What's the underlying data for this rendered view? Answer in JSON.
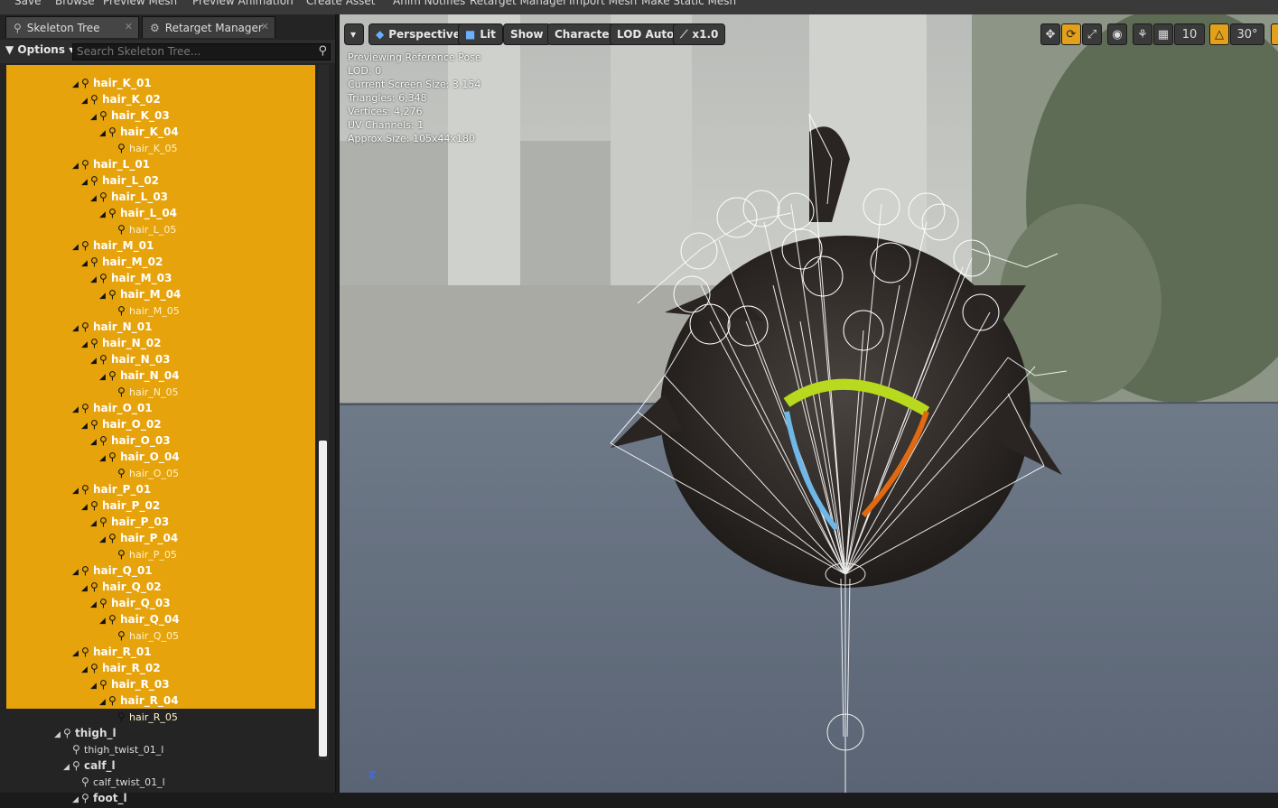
{
  "toolbar": {
    "save": "Save",
    "browse": "Browse",
    "preview_mesh": "Preview Mesh",
    "preview_animation": "Preview Animation",
    "create_asset": "Create Asset",
    "anim_notifies": "Anim Notifies",
    "retarget_manager": "Retarget Manager",
    "import_mesh": "Import Mesh",
    "make_static_mesh": "Make Static Mesh"
  },
  "tabs": {
    "skeleton_tree": "Skeleton Tree",
    "retarget_manager": "Retarget Manager"
  },
  "skeleton_tree": {
    "options_label": "Options",
    "search_placeholder": "Search Skeleton Tree...",
    "rows": [
      {
        "label": "hair_K_01",
        "level": 0,
        "kind": "parent",
        "highlight": true
      },
      {
        "label": "hair_K_02",
        "level": 1,
        "kind": "parent",
        "highlight": true
      },
      {
        "label": "hair_K_03",
        "level": 2,
        "kind": "parent",
        "highlight": true
      },
      {
        "label": "hair_K_04",
        "level": 3,
        "kind": "parent",
        "highlight": true
      },
      {
        "label": "hair_K_05",
        "level": 4,
        "kind": "leaf",
        "highlight": true
      },
      {
        "label": "hair_L_01",
        "level": 0,
        "kind": "parent",
        "highlight": true
      },
      {
        "label": "hair_L_02",
        "level": 1,
        "kind": "parent",
        "highlight": true
      },
      {
        "label": "hair_L_03",
        "level": 2,
        "kind": "parent",
        "highlight": true
      },
      {
        "label": "hair_L_04",
        "level": 3,
        "kind": "parent",
        "highlight": true
      },
      {
        "label": "hair_L_05",
        "level": 4,
        "kind": "leaf",
        "highlight": true
      },
      {
        "label": "hair_M_01",
        "level": 0,
        "kind": "parent",
        "highlight": true
      },
      {
        "label": "hair_M_02",
        "level": 1,
        "kind": "parent",
        "highlight": true
      },
      {
        "label": "hair_M_03",
        "level": 2,
        "kind": "parent",
        "highlight": true
      },
      {
        "label": "hair_M_04",
        "level": 3,
        "kind": "parent",
        "highlight": true
      },
      {
        "label": "hair_M_05",
        "level": 4,
        "kind": "leaf",
        "highlight": true
      },
      {
        "label": "hair_N_01",
        "level": 0,
        "kind": "parent",
        "highlight": true
      },
      {
        "label": "hair_N_02",
        "level": 1,
        "kind": "parent",
        "highlight": true
      },
      {
        "label": "hair_N_03",
        "level": 2,
        "kind": "parent",
        "highlight": true
      },
      {
        "label": "hair_N_04",
        "level": 3,
        "kind": "parent",
        "highlight": true
      },
      {
        "label": "hair_N_05",
        "level": 4,
        "kind": "leaf",
        "highlight": true
      },
      {
        "label": "hair_O_01",
        "level": 0,
        "kind": "parent",
        "highlight": true
      },
      {
        "label": "hair_O_02",
        "level": 1,
        "kind": "parent",
        "highlight": true
      },
      {
        "label": "hair_O_03",
        "level": 2,
        "kind": "parent",
        "highlight": true
      },
      {
        "label": "hair_O_04",
        "level": 3,
        "kind": "parent",
        "highlight": true
      },
      {
        "label": "hair_O_05",
        "level": 4,
        "kind": "leaf",
        "highlight": true
      },
      {
        "label": "hair_P_01",
        "level": 0,
        "kind": "parent",
        "highlight": true
      },
      {
        "label": "hair_P_02",
        "level": 1,
        "kind": "parent",
        "highlight": true
      },
      {
        "label": "hair_P_03",
        "level": 2,
        "kind": "parent",
        "highlight": true
      },
      {
        "label": "hair_P_04",
        "level": 3,
        "kind": "parent",
        "highlight": true
      },
      {
        "label": "hair_P_05",
        "level": 4,
        "kind": "leaf",
        "highlight": true
      },
      {
        "label": "hair_Q_01",
        "level": 0,
        "kind": "parent",
        "highlight": true
      },
      {
        "label": "hair_Q_02",
        "level": 1,
        "kind": "parent",
        "highlight": true
      },
      {
        "label": "hair_Q_03",
        "level": 2,
        "kind": "parent",
        "highlight": true
      },
      {
        "label": "hair_Q_04",
        "level": 3,
        "kind": "parent",
        "highlight": true
      },
      {
        "label": "hair_Q_05",
        "level": 4,
        "kind": "leaf",
        "highlight": true
      },
      {
        "label": "hair_R_01",
        "level": 0,
        "kind": "parent",
        "highlight": true
      },
      {
        "label": "hair_R_02",
        "level": 1,
        "kind": "parent",
        "highlight": true
      },
      {
        "label": "hair_R_03",
        "level": 2,
        "kind": "parent",
        "highlight": true
      },
      {
        "label": "hair_R_04",
        "level": 3,
        "kind": "parent",
        "highlight": true
      },
      {
        "label": "hair_R_05",
        "level": 4,
        "kind": "leaf",
        "highlight": true
      },
      {
        "label": "thigh_l",
        "level": -2,
        "kind": "dark-parent",
        "highlight": false
      },
      {
        "label": "thigh_twist_01_l",
        "level": -1,
        "kind": "dark-leaf",
        "highlight": false
      },
      {
        "label": "calf_l",
        "level": -1,
        "kind": "dark-parent",
        "highlight": false
      },
      {
        "label": "calf_twist_01_l",
        "level": 0,
        "kind": "dark-leaf",
        "highlight": false
      },
      {
        "label": "foot_l",
        "level": 0,
        "kind": "dark-parent",
        "highlight": false
      }
    ]
  },
  "viewport": {
    "menu_button": "▾",
    "perspective": "Perspective",
    "lit": "Lit",
    "show": "Show",
    "character": "Character",
    "lod_auto": "LOD Auto",
    "play_speed": "x1.0",
    "grid_snap_value": "10",
    "rotation_snap_value": "30°",
    "axis_label": "Z",
    "stats": [
      "Previewing Reference Pose",
      "LOD: 0",
      "Current Screen Size: 3.154",
      "Triangles: 6,348",
      "Vertices: 4,276",
      "UV Channels: 1",
      "Approx Size: 105x44x180"
    ]
  },
  "colors": {
    "highlight": "#e6a30c",
    "accent_orange": "#e2a01b",
    "floor": "#6e7a8e"
  }
}
